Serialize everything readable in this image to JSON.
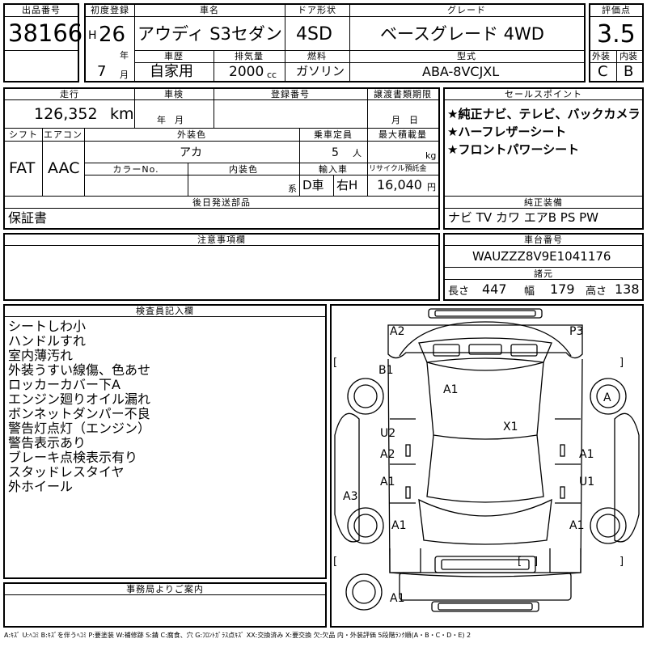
{
  "header": {
    "lot_no_label": "出品番号",
    "lot_no": "38166",
    "first_reg_label": "初度登録",
    "era_letter": "H",
    "era_year": "26",
    "year_unit": "年",
    "month": "7",
    "month_unit": "月",
    "car_name_label": "車名",
    "car_name": "アウディ S3セダン",
    "door_label": "ドア形状",
    "door": "4SD",
    "grade_label": "グレード",
    "grade": "ベースグレード 4WD",
    "score_label": "評価点",
    "score": "3.5",
    "history_label": "車歴",
    "history": "自家用",
    "displacement_label": "排気量",
    "displacement": "2000",
    "displacement_unit": "cc",
    "fuel_label": "燃料",
    "fuel": "ガソリン",
    "model_label": "型式",
    "model": "ABA-8VCJXL",
    "ext_label": "外装",
    "ext_grade": "C",
    "int_label": "内装",
    "int_grade": "B"
  },
  "row2": {
    "mileage_label": "走行",
    "mileage": "126,352",
    "mileage_unit": "km",
    "inspection_label": "車検",
    "inspection_unit": "年　月",
    "reg_no_label": "登録番号",
    "transfer_label": "譲渡書類期限",
    "transfer_unit": "月　日",
    "shift_label": "シフト",
    "shift": "FAT",
    "ac_label": "エアコン",
    "ac": "AAC",
    "color_label": "外装色",
    "color": "アカ",
    "capacity_label": "乗車定員",
    "capacity": "5",
    "capacity_unit": "人",
    "load_label": "最大積載量",
    "load_unit": "kg",
    "color_no_label": "カラーNo.",
    "int_color_label": "内装色",
    "int_color_unit": "系",
    "import_label": "輸入車",
    "import_drive": "D車",
    "import_hand": "右H",
    "recycle_label": "リサイクル預託金",
    "recycle": "16,040",
    "recycle_unit": "円",
    "delivery_label": "後日発送部品",
    "delivery": "保証書"
  },
  "sales": {
    "label": "セールスポイント",
    "points": [
      "★純正ナビ、テレビ、バックカメラ",
      "★ハーフレザーシート",
      "★フロントパワーシート"
    ]
  },
  "equipment": {
    "label": "純正装備",
    "value": "ナビ TV カワ エアB PS PW"
  },
  "notes": {
    "label": "注意事項欄"
  },
  "chassis": {
    "label": "車台番号",
    "value": "WAUZZZ8V9E1041176",
    "dims_label": "諸元",
    "length_label": "長さ",
    "length": "447",
    "width_label": "幅",
    "width": "179",
    "height_label": "高さ",
    "height": "138"
  },
  "inspector": {
    "label": "検査員記入欄",
    "items": [
      "シートしわ小",
      "ハンドルすれ",
      "室内薄汚れ",
      "外装うすい線傷、色あせ",
      "ロッカーカバー下A",
      "エンジン廻りオイル漏れ",
      "ボンネットダンパー不良",
      "警告灯点灯（エンジン）",
      "警告表示あり",
      "ブレーキ点検表示有り",
      "スタッドレスタイヤ",
      "外ホイール"
    ]
  },
  "office": {
    "label": "事務局よりご案内"
  },
  "diagram": {
    "marks": [
      "A2",
      "P3",
      "B1",
      "A1",
      "A",
      "X1",
      "U2",
      "A2",
      "A1",
      "A1",
      "U1",
      "A3",
      "A1",
      "A1",
      "A1"
    ],
    "brackets": [
      "[",
      "]",
      "[",
      "]",
      "[",
      "]"
    ]
  },
  "legend": "A:ｷｽﾞ U:ﾍｺﾐ B:ｷｽﾞを伴うﾍｺﾐ P:要塗装 W:補修跡 S:錆 C:腐食、穴 G:ﾌﾛﾝﾄｶﾞﾗｽ点ｷｽﾞ XX:交換済み X:要交換 欠:欠品 内・外装評価 5段階ﾗﾝｸ順(A・B・C・D・E) 2"
}
